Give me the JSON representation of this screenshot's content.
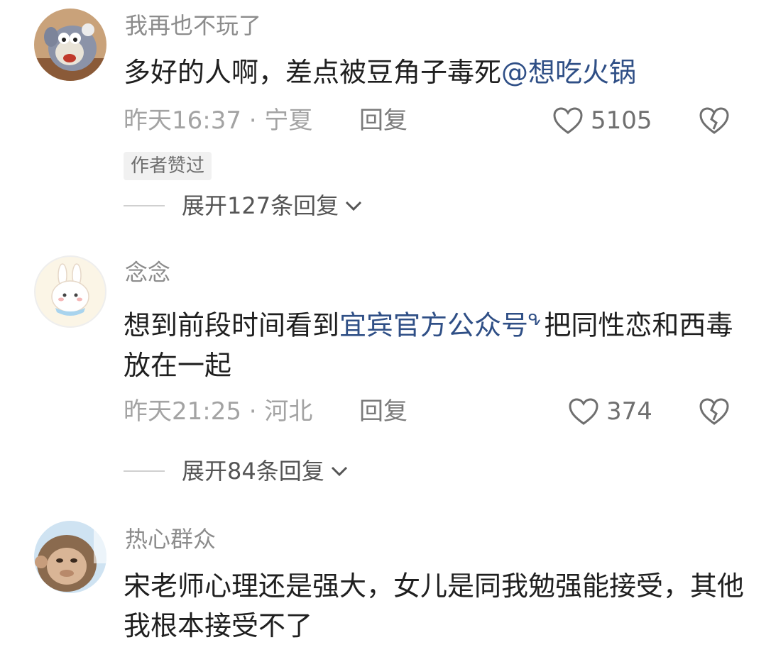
{
  "comments": [
    {
      "username": "我再也不玩了",
      "text_before": "多好的人啊，差点被豆角子毒死",
      "mention": "@想吃火锅",
      "text_after": "",
      "time": "昨天16:37",
      "location": "宁夏",
      "reply_label": "回复",
      "likes": "5105",
      "badge": "作者赞过",
      "expand": "展开127条回复",
      "avatar": "cartoon-cat-avatar"
    },
    {
      "username": "念念",
      "text_before": "想到前段时间看到",
      "mention": "宜宾官方公众号",
      "search_mark": "ᕴ",
      "text_after": "把同性恋和西毒放在一起",
      "time": "昨天21:25",
      "location": "河北",
      "reply_label": "回复",
      "likes": "374",
      "expand": "展开84条回复",
      "avatar": "bunny-avatar"
    },
    {
      "username": "热心群众",
      "text_before": "宋老师心理还是强大，女儿是同我勉强能接受，其他我根本接受不了",
      "avatar": "monkey-avatar"
    }
  ],
  "separator": " · ",
  "colors": {
    "mention": "#2f4f86",
    "meta": "#a3a3a3",
    "username": "#8c8c8c"
  }
}
